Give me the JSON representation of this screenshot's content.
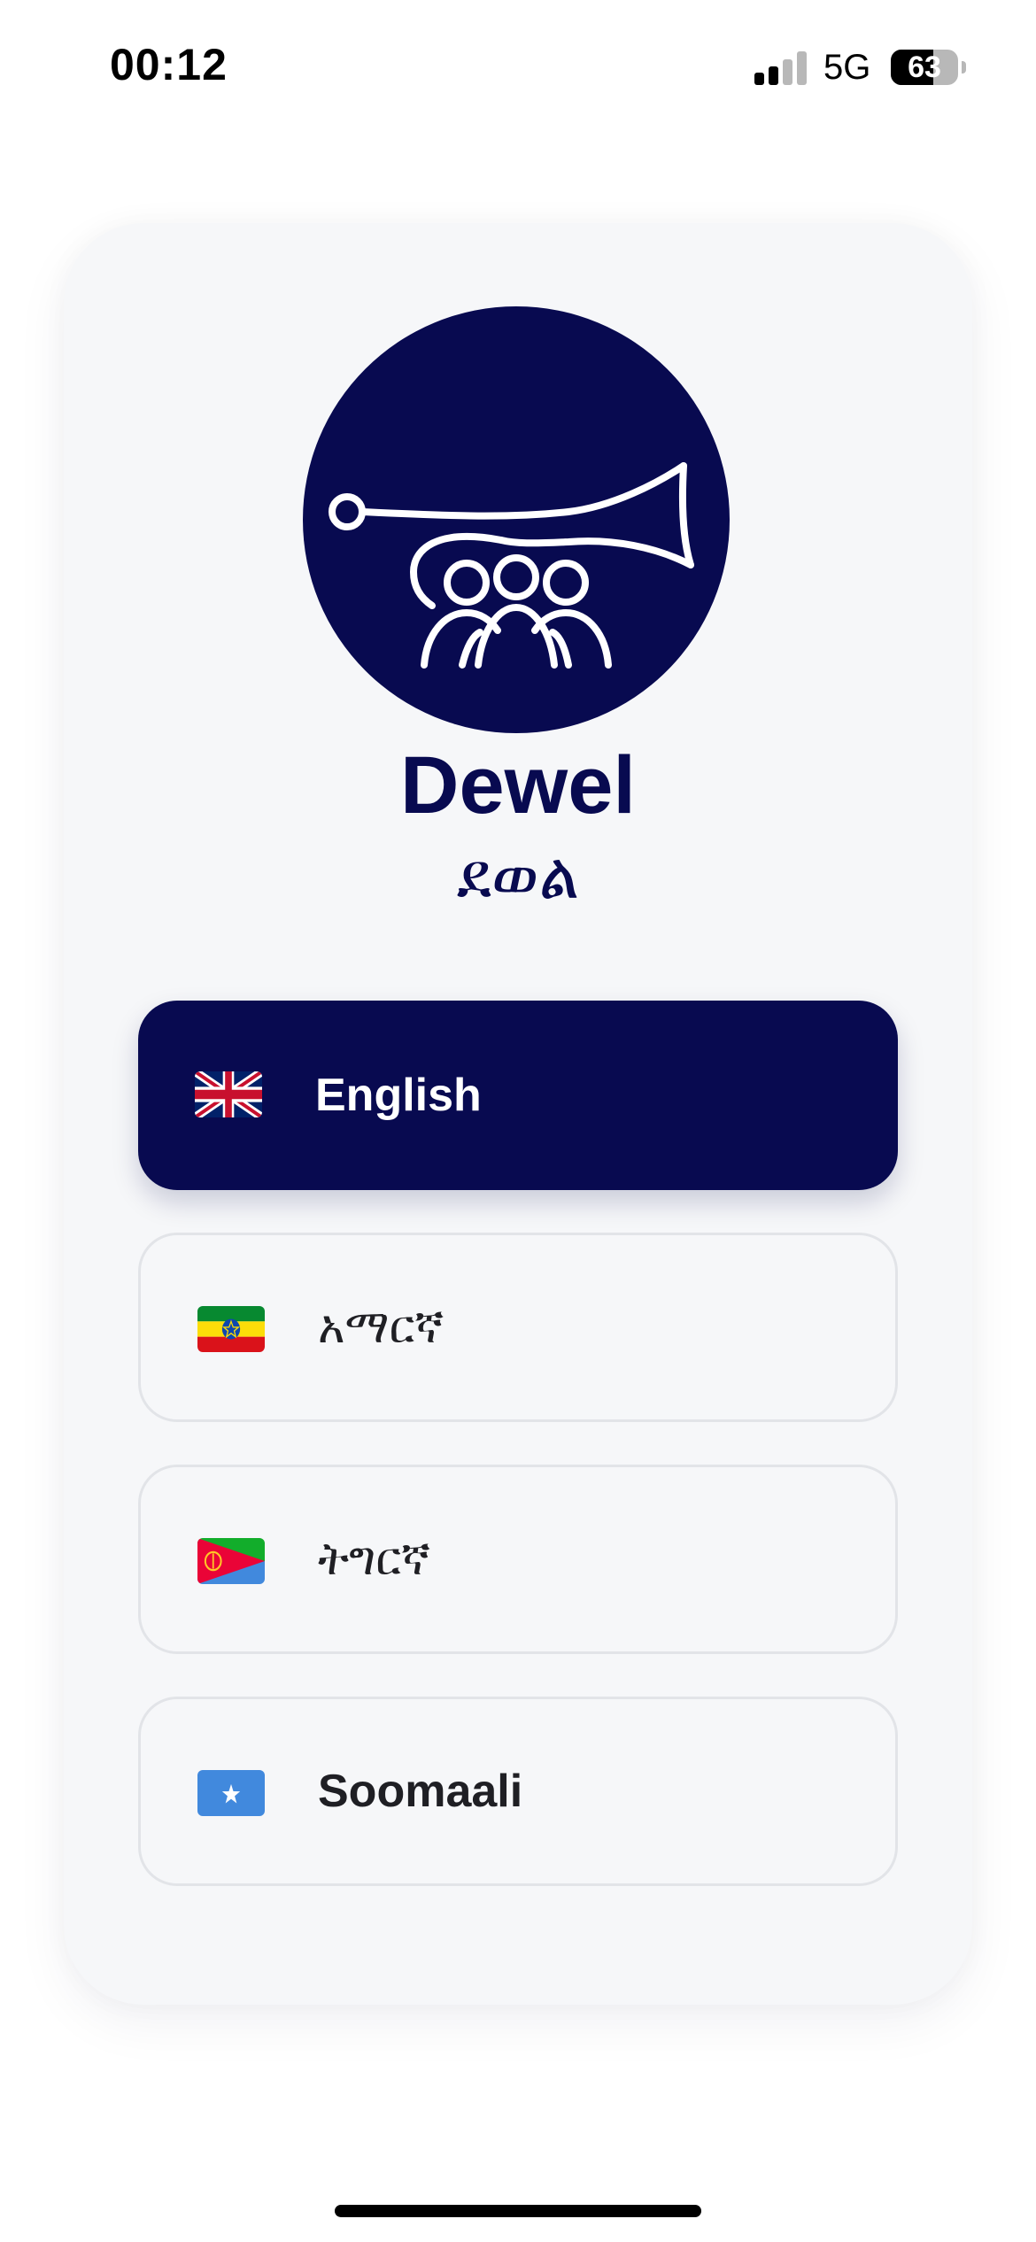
{
  "status_bar": {
    "time": "00:12",
    "network": "5G",
    "battery_percent": "63",
    "battery_level": 0.63,
    "signal_bars_active": 2,
    "signal_bars_total": 4
  },
  "app": {
    "title": "Dewel",
    "subtitle": "ደወል",
    "logo_icon": "horn-with-people-icon"
  },
  "languages": [
    {
      "label": "English",
      "flag": "uk-flag-icon",
      "selected": true
    },
    {
      "label": "አማርኛ",
      "flag": "ethiopia-flag-icon",
      "selected": false
    },
    {
      "label": "ትግርኛ",
      "flag": "eritrea-flag-icon",
      "selected": false
    },
    {
      "label": "Soomaali",
      "flag": "somalia-flag-icon",
      "selected": false
    }
  ],
  "colors": {
    "brand": "#080a50",
    "card_background": "#f6f7f9",
    "option_border": "#e2e4e8",
    "text_dark": "#1f1f24"
  }
}
